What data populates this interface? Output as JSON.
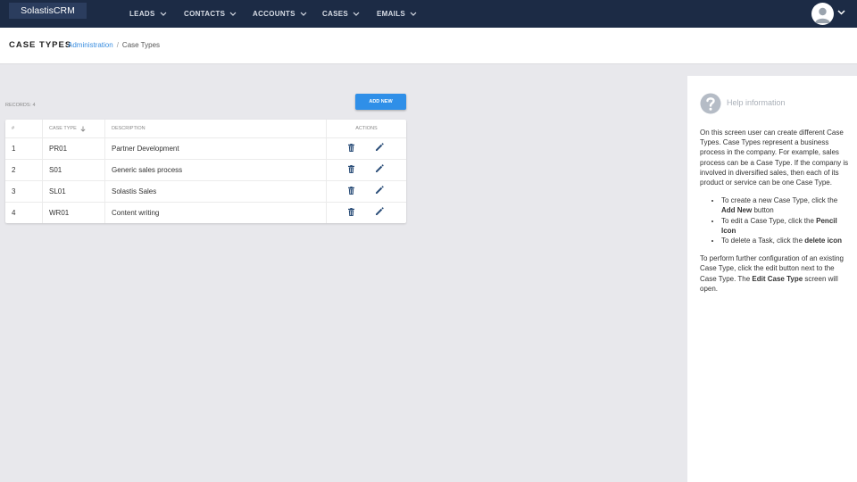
{
  "app": {
    "logo": "SolastisCRM"
  },
  "nav": [
    {
      "label": "LEADS"
    },
    {
      "label": "CONTACTS"
    },
    {
      "label": "ACCOUNTS"
    },
    {
      "label": "CASES"
    },
    {
      "label": "EMAILS"
    }
  ],
  "header": {
    "title": "CASE TYPES",
    "breadcrumb": {
      "link": "Administration",
      "separator": "/",
      "current": "Case Types"
    }
  },
  "list": {
    "records_label": "RECORDS: 4",
    "add_button": "ADD NEW",
    "columns": [
      "#",
      "CASE TYPE",
      "DESCRIPTION",
      "ACTIONS"
    ],
    "rows": [
      {
        "num": "1",
        "code": "PR01",
        "desc": "Partner Development"
      },
      {
        "num": "2",
        "code": "S01",
        "desc": "Generic sales process"
      },
      {
        "num": "3",
        "code": "SL01",
        "desc": "Solastis Sales"
      },
      {
        "num": "4",
        "code": "WR01",
        "desc": "Content writing"
      }
    ]
  },
  "help": {
    "title": "Help information",
    "intro": "On this screen user can create different Case Types. Case Types represent a business process in the company. For example, sales process can be a Case Type. If the company is involved in diversified sales, then each of its product or service can be one Case Type.",
    "bullets": [
      {
        "pre": "To create a new Case Type, click the ",
        "bold": "Add New",
        "post": " button"
      },
      {
        "pre": "To edit a Case Type, click the ",
        "bold": "Pencil Icon",
        "post": ""
      },
      {
        "pre": "To delete a Task, click the ",
        "bold": "delete icon",
        "post": ""
      }
    ],
    "outro_pre": "To perform further configuration of an existing Case Type, click the edit button next to the Case Type. The ",
    "outro_bold": "Edit Case Type",
    "outro_post": " screen will open."
  },
  "colors": {
    "nav_bg": "#1c2b45",
    "accent": "#2f8fe8",
    "link": "#3a8ee0",
    "icon": "#2a4d78"
  }
}
